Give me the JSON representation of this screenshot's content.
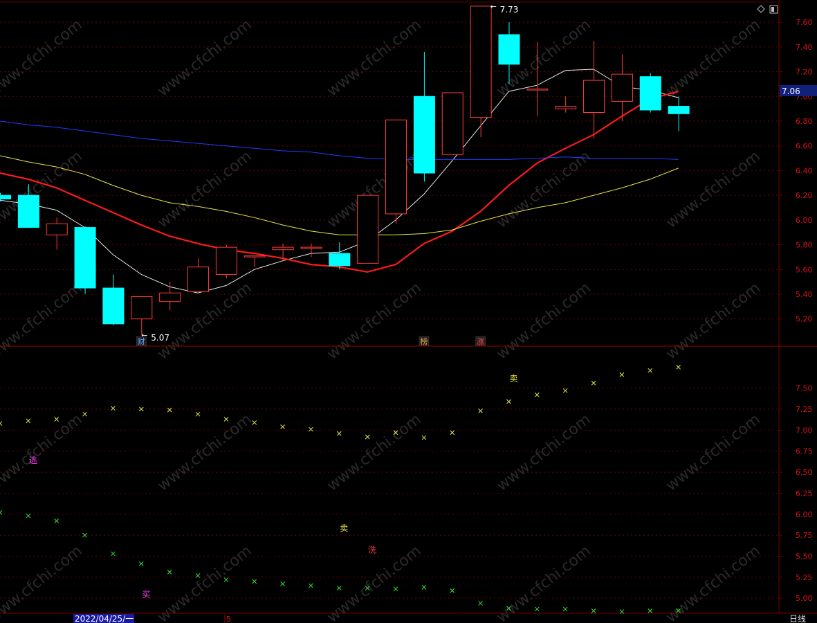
{
  "colors": {
    "background": "#000000",
    "border": "#7a0000",
    "grid": "#6e0000",
    "axis_text": "#d4141b",
    "up_candle": "#ff3c3c",
    "down_candle": "#00ffff",
    "ma_fast": "#e8e8e8",
    "ma_mid": "#ff1a1a",
    "ma_slow": "#e6e64a",
    "ma_long": "#1f3dff",
    "sar_upper": "#e6e64a",
    "sar_lower": "#33e633"
  },
  "icons": {
    "top_right": [
      "diamond-icon",
      "window-toggle-icon"
    ]
  },
  "watermark": "www.cfchi.com",
  "price_panel": {
    "current_price_label": "7.06",
    "ylim": [
      4.98,
      7.78
    ],
    "yticks": [
      5.2,
      5.4,
      5.6,
      5.8,
      6.0,
      6.2,
      6.4,
      6.6,
      6.8,
      7.0,
      7.2,
      7.4,
      7.6
    ],
    "ytick_labels": [
      "5.20",
      "5.40",
      "5.60",
      "5.80",
      "6.00",
      "6.20",
      "6.40",
      "6.60",
      "6.80",
      "7.00",
      "7.20",
      "7.40",
      "7.60"
    ],
    "high_marker": "7.73",
    "low_marker": "5.07",
    "event_labels": [
      {
        "index": 5,
        "text": "财",
        "color": "#5aa0ff"
      },
      {
        "index": 15,
        "text": "榜",
        "color": "#e0a040"
      },
      {
        "index": 17,
        "text": "涨",
        "color": "#ff4040"
      }
    ]
  },
  "indicator_panel": {
    "ylim": [
      4.82,
      8.0
    ],
    "yticks": [
      5.0,
      5.25,
      5.5,
      5.75,
      6.0,
      6.25,
      6.5,
      6.75,
      7.0,
      7.25,
      7.5
    ],
    "ytick_labels": [
      "5.00",
      "5.25",
      "5.50",
      "5.75",
      "6.00",
      "6.25",
      "6.50",
      "6.75",
      "7.00",
      "7.25",
      "7.50"
    ],
    "signals": [
      {
        "index": 1,
        "value": 6.65,
        "text": "逃",
        "color": "#ff40ff"
      },
      {
        "index": 5,
        "value": 5.05,
        "text": "买",
        "color": "#ff40ff"
      },
      {
        "index": 12,
        "value": 5.84,
        "text": "卖",
        "color": "#e6e64a"
      },
      {
        "index": 13,
        "value": 5.58,
        "text": "洗",
        "color": "#ff4040"
      },
      {
        "index": 18,
        "value": 7.62,
        "text": "卖",
        "color": "#e6e64a"
      }
    ]
  },
  "bottom_bar": {
    "date_label": "2022/04/25/一",
    "month_label": "5",
    "period_button": "日线"
  },
  "chart_data": [
    {
      "type": "candlestick",
      "x": [
        0,
        1,
        2,
        3,
        4,
        5,
        6,
        7,
        8,
        9,
        10,
        11,
        12,
        13,
        14,
        15,
        16,
        17,
        18,
        19,
        20,
        21,
        22,
        23,
        24
      ],
      "open": [
        6.2,
        6.2,
        5.88,
        5.94,
        5.45,
        5.2,
        5.34,
        5.42,
        5.56,
        5.71,
        5.76,
        5.77,
        5.73,
        5.65,
        6.05,
        7.0,
        6.53,
        6.83,
        7.5,
        7.06,
        6.9,
        6.87,
        6.96,
        7.16,
        6.92
      ],
      "close": [
        6.17,
        5.94,
        5.97,
        5.45,
        5.16,
        5.38,
        5.41,
        5.62,
        5.78,
        5.71,
        5.78,
        5.78,
        5.63,
        6.2,
        6.81,
        6.38,
        7.03,
        7.73,
        7.26,
        7.06,
        6.92,
        7.13,
        7.18,
        6.89,
        6.86
      ],
      "high": [
        6.22,
        6.29,
        6.02,
        5.95,
        5.56,
        5.38,
        5.5,
        5.69,
        5.8,
        5.71,
        5.81,
        5.81,
        5.82,
        6.2,
        6.81,
        7.36,
        7.03,
        7.73,
        7.6,
        7.44,
        7.0,
        7.45,
        7.34,
        7.19,
        7.0
      ],
      "low": [
        6.15,
        5.94,
        5.76,
        5.4,
        5.15,
        5.07,
        5.27,
        5.44,
        5.53,
        5.62,
        5.67,
        5.7,
        5.6,
        5.65,
        5.97,
        6.31,
        6.53,
        6.67,
        7.1,
        6.84,
        6.87,
        6.66,
        6.8,
        6.87,
        6.72
      ],
      "ma": [
        {
          "color": "#e8e8e8",
          "values": [
            6.16,
            6.13,
            6.08,
            5.94,
            5.72,
            5.56,
            5.46,
            5.41,
            5.47,
            5.6,
            5.67,
            5.73,
            5.74,
            5.83,
            6.0,
            6.21,
            6.48,
            6.76,
            7.04,
            7.09,
            7.21,
            7.22,
            7.08,
            7.05,
            6.99
          ]
        },
        {
          "color": "#ff1a1a",
          "values": [
            6.38,
            6.33,
            6.26,
            6.16,
            6.06,
            5.96,
            5.87,
            5.81,
            5.76,
            5.73,
            5.69,
            5.64,
            5.62,
            5.58,
            5.64,
            5.81,
            5.91,
            6.07,
            6.28,
            6.46,
            6.58,
            6.69,
            6.84,
            6.98,
            7.04
          ]
        },
        {
          "color": "#e6e64a",
          "values": [
            6.52,
            6.47,
            6.43,
            6.37,
            6.28,
            6.2,
            6.14,
            6.11,
            6.07,
            6.02,
            5.96,
            5.91,
            5.88,
            5.88,
            5.88,
            5.89,
            5.92,
            5.99,
            6.05,
            6.1,
            6.14,
            6.2,
            6.26,
            6.33,
            6.42
          ]
        },
        {
          "color": "#1f3dff",
          "values": [
            6.8,
            6.77,
            6.75,
            6.72,
            6.69,
            6.66,
            6.64,
            6.62,
            6.6,
            6.58,
            6.56,
            6.55,
            6.52,
            6.5,
            6.49,
            6.49,
            6.49,
            6.49,
            6.49,
            6.5,
            6.51,
            6.5,
            6.5,
            6.5,
            6.49
          ]
        }
      ]
    },
    {
      "type": "scatter",
      "x": [
        0,
        1,
        2,
        3,
        4,
        5,
        6,
        7,
        8,
        9,
        10,
        11,
        12,
        13,
        14,
        15,
        16,
        17,
        18,
        19,
        20,
        21,
        22,
        23,
        24
      ],
      "series": [
        {
          "values": [
            7.08,
            7.11,
            7.13,
            7.19,
            7.26,
            7.25,
            7.24,
            7.19,
            7.13,
            7.09,
            7.04,
            7.01,
            6.96,
            6.92,
            6.97,
            6.91,
            6.97,
            7.23,
            7.34,
            7.42,
            7.47,
            7.56,
            7.66,
            7.71,
            7.75
          ]
        },
        {
          "values": [
            6.02,
            5.98,
            5.92,
            5.75,
            5.53,
            5.41,
            5.31,
            5.27,
            5.22,
            5.2,
            5.17,
            5.15,
            5.12,
            5.12,
            5.11,
            5.13,
            5.09,
            4.94,
            4.88,
            4.87,
            4.87,
            4.85,
            4.84,
            4.85,
            4.85
          ]
        }
      ]
    }
  ]
}
